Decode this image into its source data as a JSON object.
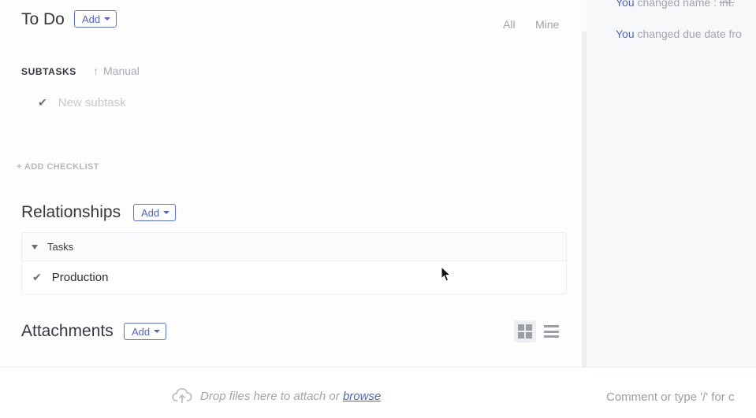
{
  "todo": {
    "title": "To Do",
    "add_label": "Add"
  },
  "filters": {
    "all": "All",
    "mine": "Mine"
  },
  "subtasks": {
    "label": "SUBTASKS",
    "sort_label": "Manual",
    "placeholder": "New subtask"
  },
  "checklist": {
    "add_label": "+ ADD CHECKLIST"
  },
  "relationships": {
    "title": "Relationships",
    "add_label": "Add",
    "group_label": "Tasks",
    "items": [
      {
        "label": "Production"
      }
    ]
  },
  "attachments": {
    "title": "Attachments",
    "add_label": "Add"
  },
  "activity": {
    "items": [
      {
        "who": "You",
        "text": " changed name : ",
        "struck": "int."
      },
      {
        "who": "You",
        "text": " changed due date fro"
      }
    ]
  },
  "bottom": {
    "drop_text": "Drop files here to attach or ",
    "browse_link": "browse",
    "comment_placeholder": "Comment or type '/' for c"
  },
  "colors": {
    "accent": "#4f67c0",
    "muted": "#a0a4ab"
  }
}
